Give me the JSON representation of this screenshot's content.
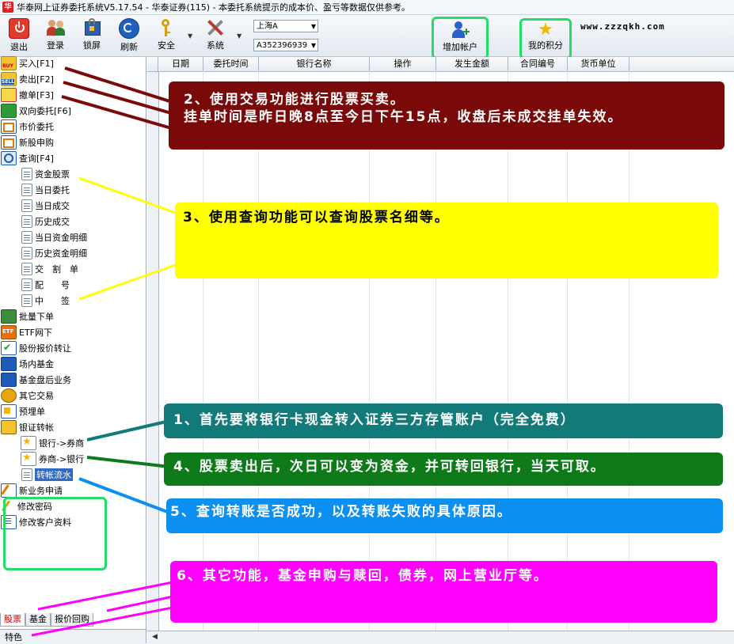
{
  "window": {
    "icon": "huatai-app-icon",
    "title": "华泰网上证券委托系统V5.17.54 - 华泰证券(115) - 本委托系统提示的成本价、盈亏等数据仅供参考。"
  },
  "toolbar": {
    "logout": "退出",
    "login": "登录",
    "lock": "锁屏",
    "refresh": "刷新",
    "security": "安全",
    "system": "系统",
    "market": "上海A",
    "account": "A352396939",
    "add_account": "增加帐户",
    "my_points": "我的积分",
    "site": "www.zzzqkh.com"
  },
  "sidebar": {
    "items": [
      {
        "label": "买入[F1]",
        "icon": "buy-icon"
      },
      {
        "label": "卖出[F2]",
        "icon": "sell-icon"
      },
      {
        "label": "撤单[F3]",
        "icon": "cancel-order-icon"
      },
      {
        "label": "双向委托[F6]",
        "icon": "two-way-order-icon"
      },
      {
        "label": "市价委托",
        "icon": "market-order-icon"
      },
      {
        "label": "新股申购",
        "icon": "ipo-subscribe-icon"
      },
      {
        "label": "查询[F4]",
        "icon": "query-icon"
      }
    ],
    "query_sub": [
      "资金股票",
      "当日委托",
      "当日成交",
      "历史成交",
      "当日资金明细",
      "历史资金明细",
      "交　割　单",
      "配　　号",
      "中　　签"
    ],
    "items2": [
      {
        "label": "批量下单",
        "icon": "batch-order-icon"
      },
      {
        "label": "ETF网下",
        "icon": "etf-icon"
      },
      {
        "label": "股份报价转让",
        "icon": "share-transfer-icon"
      },
      {
        "label": "场内基金",
        "icon": "fund-icon"
      },
      {
        "label": "基金盘后业务",
        "icon": "fund-afterhours-icon"
      },
      {
        "label": "其它交易",
        "icon": "other-trade-icon"
      },
      {
        "label": "预埋单",
        "icon": "preset-order-icon"
      },
      {
        "label": "银证转帐",
        "icon": "bank-transfer-icon"
      }
    ],
    "transfer_sub": [
      "银行->券商",
      "券商->银行",
      "转帐流水"
    ],
    "items3": [
      {
        "label": "新业务申请",
        "icon": "new-business-icon"
      },
      {
        "label": "修改密码",
        "icon": "change-password-icon"
      },
      {
        "label": "修改客户资料",
        "icon": "edit-profile-icon"
      }
    ],
    "bottom_tabs": [
      "股票",
      "基金",
      "报价回购"
    ],
    "feature": "特色"
  },
  "grid": {
    "columns": [
      "日期",
      "委托时间",
      "银行名称",
      "操作",
      "发生金额",
      "合同编号",
      "货币单位"
    ]
  },
  "callouts": {
    "c1": "1、首先要将银行卡现金转入证券三方存管账户（完全免费）",
    "c2_line1": "2、使用交易功能进行股票买卖。",
    "c2_line2": "挂单时间是昨日晚8点至今日下午15点，收盘后未成交挂单失效。",
    "c3": "3、使用查询功能可以查询股票名细等。",
    "c4": "4、股票卖出后，次日可以变为资金，并可转回银行，当天可取。",
    "c5": "5、查询转账是否成功，以及转账失败的具体原因。",
    "c6": "6、其它功能，基金申购与赎回，债券，网上营业厅等。"
  },
  "colors": {
    "callout1": "#137a7a",
    "callout2": "#7a0a0a",
    "callout3": "#ffff00",
    "callout4": "#0f7a1a",
    "callout5": "#0b8ff0",
    "callout6": "#ff00ff",
    "highlight_green": "#22dd66"
  }
}
